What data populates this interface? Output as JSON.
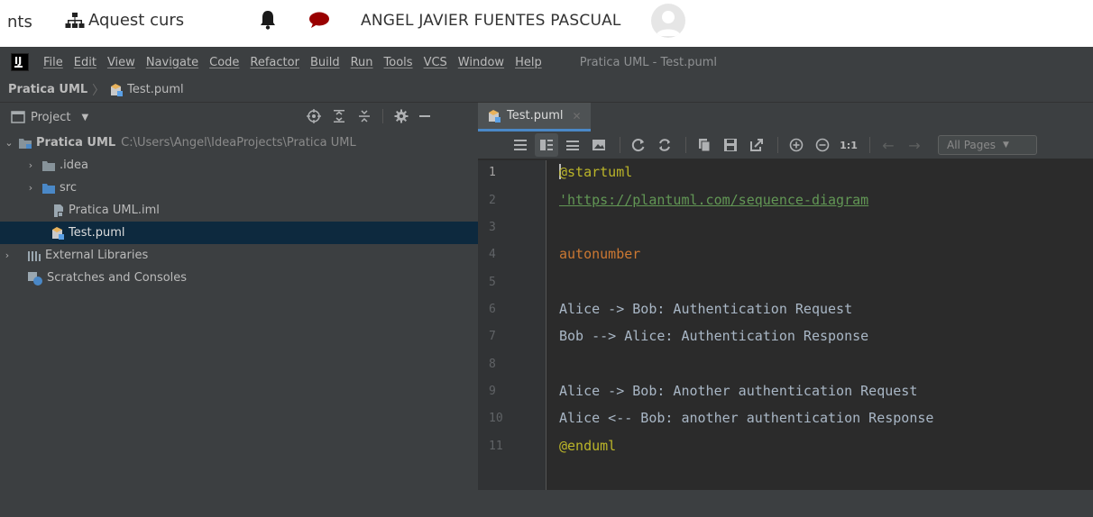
{
  "web": {
    "fragment": "nts",
    "course": "Aquest curs",
    "user": "ANGEL JAVIER FUENTES PASCUAL",
    "accent": "#990000"
  },
  "ide": {
    "menu": [
      "File",
      "Edit",
      "View",
      "Navigate",
      "Code",
      "Refactor",
      "Build",
      "Run",
      "Tools",
      "VCS",
      "Window",
      "Help"
    ],
    "window_title": "Pratica UML - Test.puml",
    "breadcrumb": {
      "project": "Pratica UML",
      "file": "Test.puml"
    },
    "project_panel": {
      "title": "Project",
      "tree": [
        {
          "label": "Pratica UML",
          "path": "C:\\Users\\Angel\\IdeaProjects\\Pratica UML"
        },
        {
          "label": ".idea"
        },
        {
          "label": "src"
        },
        {
          "label": "Pratica UML.iml"
        },
        {
          "label": "Test.puml"
        },
        {
          "label": "External Libraries"
        },
        {
          "label": "Scratches and Consoles"
        }
      ]
    },
    "editor": {
      "tab": "Test.puml",
      "zoom_label": "1:1",
      "pages": "All Pages",
      "line_numbers": [
        "1",
        "2",
        "3",
        "4",
        "5",
        "6",
        "7",
        "8",
        "9",
        "10",
        "11"
      ],
      "lines": [
        "@startuml",
        "'https://plantuml.com/sequence-diagram",
        "",
        "autonumber",
        "",
        "Alice -> Bob: Authentication Request",
        "Bob --> Alice: Authentication Response",
        "",
        "Alice -> Bob: Another authentication Request",
        "Alice <-- Bob: another authentication Response",
        "@enduml"
      ]
    },
    "colors": {
      "background": "#3c3f41",
      "editor_bg": "#2b2b2b",
      "selection": "#0d293e",
      "keyword": "#cc7832",
      "annotation": "#bbb529",
      "url": "#629755"
    }
  }
}
